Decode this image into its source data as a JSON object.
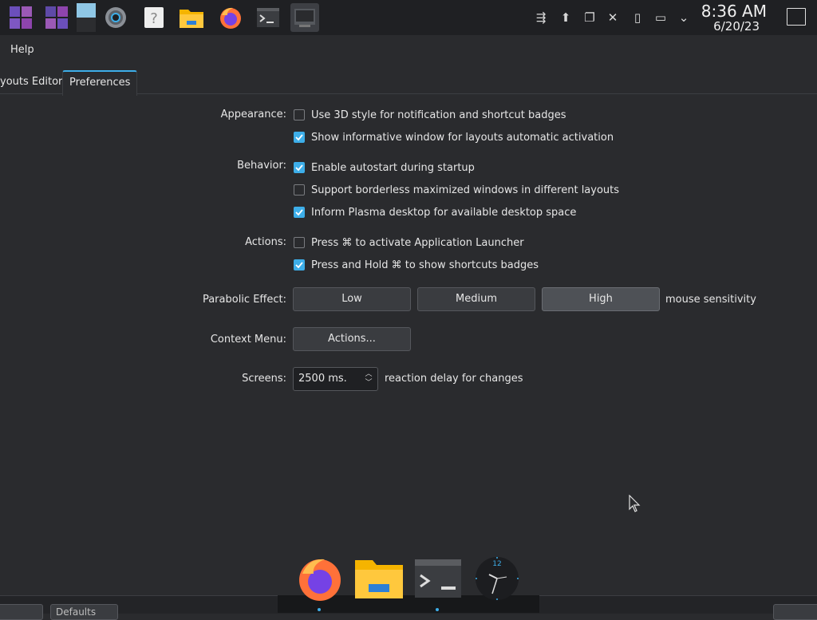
{
  "panel": {
    "clock_time": "8:36 AM",
    "clock_date": "6/20/23"
  },
  "menubar": {
    "help": "Help"
  },
  "tabs": {
    "inactive": "youts Editor",
    "active": "Preferences"
  },
  "appearance": {
    "label": "Appearance:",
    "options": [
      {
        "text": "Use 3D style for notification and shortcut badges",
        "checked": false
      },
      {
        "text": "Show informative window for layouts automatic activation",
        "checked": true
      }
    ]
  },
  "behavior": {
    "label": "Behavior:",
    "options": [
      {
        "text": "Enable autostart during startup",
        "checked": true
      },
      {
        "text": "Support borderless maximized windows in different layouts",
        "checked": false
      },
      {
        "text": "Inform Plasma desktop for available desktop space",
        "checked": true
      }
    ]
  },
  "actions": {
    "label": "Actions:",
    "options": [
      {
        "text": "Press ⌘ to activate Application Launcher",
        "checked": false
      },
      {
        "text": "Press and Hold ⌘ to show shortcuts badges",
        "checked": true
      }
    ]
  },
  "parabolic": {
    "label": "Parabolic Effect:",
    "low": "Low",
    "medium": "Medium",
    "high": "High",
    "selected": "High",
    "suffix": "mouse sensitivity"
  },
  "context_menu": {
    "label": "Context Menu:",
    "button": "Actions..."
  },
  "screens": {
    "label": "Screens:",
    "value": "2500 ms.",
    "suffix": "reaction delay for changes"
  },
  "bottom": {
    "defaults": "Defaults"
  },
  "colors": {
    "accent": "#3daee9",
    "background": "#2a2b2e",
    "panel": "#1f2023"
  }
}
